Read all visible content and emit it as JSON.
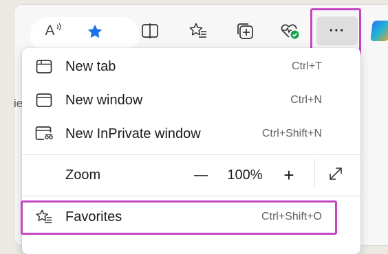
{
  "toolbar": {
    "icons": [
      "read-aloud-icon",
      "favorite-star-icon",
      "split-screen-icon",
      "favorites-icon",
      "collections-icon",
      "browser-essentials-icon",
      "more-options-icon",
      "copilot-icon"
    ],
    "read_aloud_glyph": "A",
    "more_glyph": "···",
    "accent_color": "#1a73e8",
    "highlight_color": "#c445c4"
  },
  "background_text": "ie",
  "menu": {
    "items": [
      {
        "label": "New tab",
        "shortcut": "Ctrl+T",
        "icon": "new-tab-icon"
      },
      {
        "label": "New window",
        "shortcut": "Ctrl+N",
        "icon": "new-window-icon"
      },
      {
        "label": "New InPrivate window",
        "shortcut": "Ctrl+Shift+N",
        "icon": "inprivate-icon"
      }
    ],
    "zoom": {
      "label": "Zoom",
      "minus": "—",
      "value": "100%",
      "plus": "+",
      "icon": "fullscreen-icon"
    },
    "favorites": {
      "label": "Favorites",
      "shortcut": "Ctrl+Shift+O",
      "icon": "favorites-icon"
    }
  }
}
